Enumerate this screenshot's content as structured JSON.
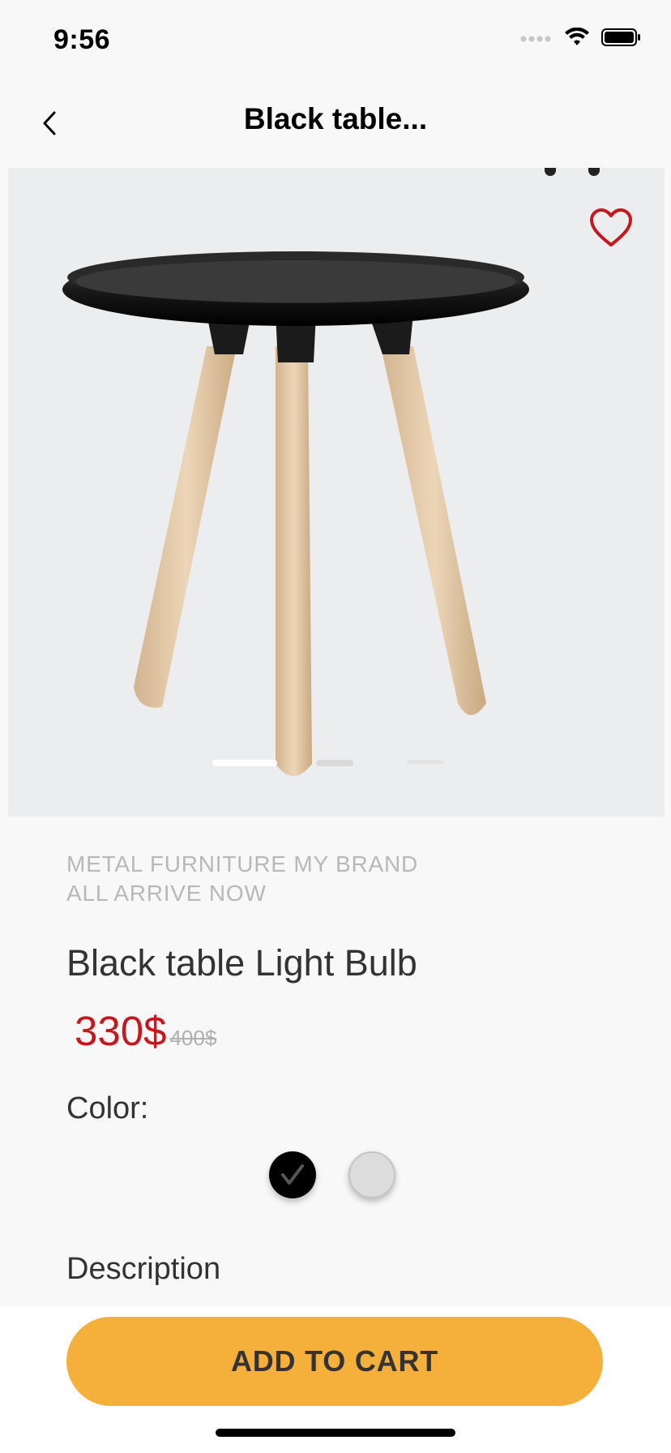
{
  "status_bar": {
    "time": "9:56"
  },
  "nav": {
    "title": "Black table..."
  },
  "hero": {
    "pager_count": 3,
    "active_index": 0,
    "favorite_color": "#c8161d"
  },
  "product": {
    "tagline_line1": "METAL FURNITURE MY BRAND",
    "tagline_line2": "ALL ARRIVE NOW",
    "name": "Black table Light Bulb",
    "price": "330$",
    "old_price": "400$",
    "color_label": "Color:",
    "colors": [
      {
        "name": "black",
        "hex": "#000000",
        "selected": true
      },
      {
        "name": "light-gray",
        "hex": "#dcdcdc",
        "selected": false
      }
    ],
    "description_label": "Description"
  },
  "cart": {
    "button_label": "ADD TO CART",
    "accent": "#f5b03b"
  }
}
